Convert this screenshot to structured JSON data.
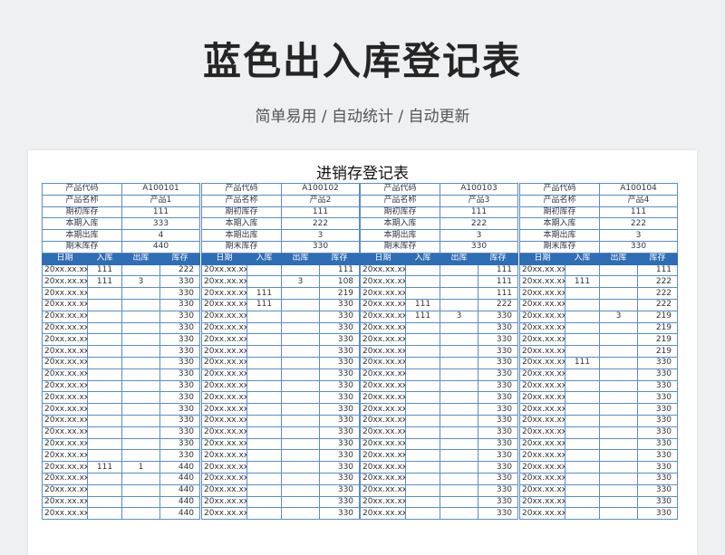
{
  "page": {
    "title": "蓝色出入库登记表",
    "subtitle": "简单易用 / 自动统计 / 自动更新"
  },
  "sheet": {
    "title": "进销存登记表",
    "info_labels": [
      "产品代码",
      "产品名称",
      "期初库存",
      "本期入库",
      "本期出库",
      "期末库存"
    ],
    "columns": [
      "日期",
      "入库",
      "出库",
      "库存"
    ],
    "products": [
      {
        "info_values": [
          "A100101",
          "产品1",
          "111",
          "333",
          "4",
          "440"
        ],
        "rows": [
          [
            "20xx.xx.xx",
            "111",
            "",
            "222"
          ],
          [
            "20xx.xx.xx",
            "111",
            "3",
            "330"
          ],
          [
            "20xx.xx.xx",
            "",
            "",
            "330"
          ],
          [
            "20xx.xx.xx",
            "",
            "",
            "330"
          ],
          [
            "20xx.xx.xx",
            "",
            "",
            "330"
          ],
          [
            "20xx.xx.xx",
            "",
            "",
            "330"
          ],
          [
            "20xx.xx.xx",
            "",
            "",
            "330"
          ],
          [
            "20xx.xx.xx",
            "",
            "",
            "330"
          ],
          [
            "20xx.xx.xx",
            "",
            "",
            "330"
          ],
          [
            "20xx.xx.xx",
            "",
            "",
            "330"
          ],
          [
            "20xx.xx.xx",
            "",
            "",
            "330"
          ],
          [
            "20xx.xx.xx",
            "",
            "",
            "330"
          ],
          [
            "20xx.xx.xx",
            "",
            "",
            "330"
          ],
          [
            "20xx.xx.xx",
            "",
            "",
            "330"
          ],
          [
            "20xx.xx.xx",
            "",
            "",
            "330"
          ],
          [
            "20xx.xx.xx",
            "",
            "",
            "330"
          ],
          [
            "20xx.xx.xx",
            "",
            "",
            "330"
          ],
          [
            "20xx.xx.xx",
            "111",
            "1",
            "440"
          ],
          [
            "20xx.xx.xx",
            "",
            "",
            "440"
          ],
          [
            "20xx.xx.xx",
            "",
            "",
            "440"
          ],
          [
            "20xx.xx.xx",
            "",
            "",
            "440"
          ],
          [
            "20xx.xx.xx",
            "",
            "",
            "440"
          ]
        ]
      },
      {
        "info_values": [
          "A100102",
          "产品2",
          "111",
          "222",
          "3",
          "330"
        ],
        "rows": [
          [
            "20xx.xx.xx",
            "",
            "",
            "111"
          ],
          [
            "20xx.xx.xx",
            "",
            "3",
            "108"
          ],
          [
            "20xx.xx.xx",
            "111",
            "",
            "219"
          ],
          [
            "20xx.xx.xx",
            "111",
            "",
            "330"
          ],
          [
            "20xx.xx.xx",
            "",
            "",
            "330"
          ],
          [
            "20xx.xx.xx",
            "",
            "",
            "330"
          ],
          [
            "20xx.xx.xx",
            "",
            "",
            "330"
          ],
          [
            "20xx.xx.xx",
            "",
            "",
            "330"
          ],
          [
            "20xx.xx.xx",
            "",
            "",
            "330"
          ],
          [
            "20xx.xx.xx",
            "",
            "",
            "330"
          ],
          [
            "20xx.xx.xx",
            "",
            "",
            "330"
          ],
          [
            "20xx.xx.xx",
            "",
            "",
            "330"
          ],
          [
            "20xx.xx.xx",
            "",
            "",
            "330"
          ],
          [
            "20xx.xx.xx",
            "",
            "",
            "330"
          ],
          [
            "20xx.xx.xx",
            "",
            "",
            "330"
          ],
          [
            "20xx.xx.xx",
            "",
            "",
            "330"
          ],
          [
            "20xx.xx.xx",
            "",
            "",
            "330"
          ],
          [
            "20xx.xx.xx",
            "",
            "",
            "330"
          ],
          [
            "20xx.xx.xx",
            "",
            "",
            "330"
          ],
          [
            "20xx.xx.xx",
            "",
            "",
            "330"
          ],
          [
            "20xx.xx.xx",
            "",
            "",
            "330"
          ],
          [
            "20xx.xx.xx",
            "",
            "",
            "330"
          ]
        ]
      },
      {
        "info_values": [
          "A100103",
          "产品3",
          "111",
          "222",
          "3",
          "330"
        ],
        "rows": [
          [
            "20xx.xx.xx",
            "",
            "",
            "111"
          ],
          [
            "20xx.xx.xx",
            "",
            "",
            "111"
          ],
          [
            "20xx.xx.xx",
            "",
            "",
            "111"
          ],
          [
            "20xx.xx.xx",
            "111",
            "",
            "222"
          ],
          [
            "20xx.xx.xx",
            "111",
            "3",
            "330"
          ],
          [
            "20xx.xx.xx",
            "",
            "",
            "330"
          ],
          [
            "20xx.xx.xx",
            "",
            "",
            "330"
          ],
          [
            "20xx.xx.xx",
            "",
            "",
            "330"
          ],
          [
            "20xx.xx.xx",
            "",
            "",
            "330"
          ],
          [
            "20xx.xx.xx",
            "",
            "",
            "330"
          ],
          [
            "20xx.xx.xx",
            "",
            "",
            "330"
          ],
          [
            "20xx.xx.xx",
            "",
            "",
            "330"
          ],
          [
            "20xx.xx.xx",
            "",
            "",
            "330"
          ],
          [
            "20xx.xx.xx",
            "",
            "",
            "330"
          ],
          [
            "20xx.xx.xx",
            "",
            "",
            "330"
          ],
          [
            "20xx.xx.xx",
            "",
            "",
            "330"
          ],
          [
            "20xx.xx.xx",
            "",
            "",
            "330"
          ],
          [
            "20xx.xx.xx",
            "",
            "",
            "330"
          ],
          [
            "20xx.xx.xx",
            "",
            "",
            "330"
          ],
          [
            "20xx.xx.xx",
            "",
            "",
            "330"
          ],
          [
            "20xx.xx.xx",
            "",
            "",
            "330"
          ],
          [
            "20xx.xx.xx",
            "",
            "",
            "330"
          ]
        ]
      },
      {
        "info_values": [
          "A100104",
          "产品4",
          "111",
          "222",
          "3",
          "330"
        ],
        "rows": [
          [
            "20xx.xx.xx",
            "",
            "",
            "111"
          ],
          [
            "20xx.xx.xx",
            "111",
            "",
            "222"
          ],
          [
            "20xx.xx.xx",
            "",
            "",
            "222"
          ],
          [
            "20xx.xx.xx",
            "",
            "",
            "222"
          ],
          [
            "20xx.xx.xx",
            "",
            "3",
            "219"
          ],
          [
            "20xx.xx.xx",
            "",
            "",
            "219"
          ],
          [
            "20xx.xx.xx",
            "",
            "",
            "219"
          ],
          [
            "20xx.xx.xx",
            "",
            "",
            "219"
          ],
          [
            "20xx.xx.xx",
            "111",
            "",
            "330"
          ],
          [
            "20xx.xx.xx",
            "",
            "",
            "330"
          ],
          [
            "20xx.xx.xx",
            "",
            "",
            "330"
          ],
          [
            "20xx.xx.xx",
            "",
            "",
            "330"
          ],
          [
            "20xx.xx.xx",
            "",
            "",
            "330"
          ],
          [
            "20xx.xx.xx",
            "",
            "",
            "330"
          ],
          [
            "20xx.xx.xx",
            "",
            "",
            "330"
          ],
          [
            "20xx.xx.xx",
            "",
            "",
            "330"
          ],
          [
            "20xx.xx.xx",
            "",
            "",
            "330"
          ],
          [
            "20xx.xx.xx",
            "",
            "",
            "330"
          ],
          [
            "20xx.xx.xx",
            "",
            "",
            "330"
          ],
          [
            "20xx.xx.xx",
            "",
            "",
            "330"
          ],
          [
            "20xx.xx.xx",
            "",
            "",
            "330"
          ],
          [
            "20xx.xx.xx",
            "",
            "",
            "330"
          ]
        ]
      }
    ]
  }
}
